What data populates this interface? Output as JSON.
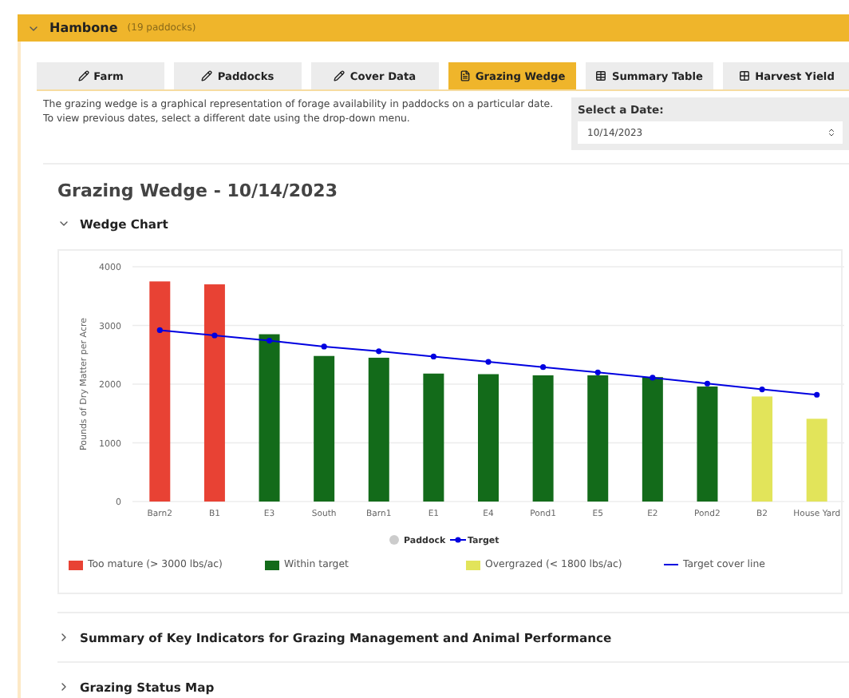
{
  "farm": {
    "name": "Hambone",
    "count": "(19 paddocks)",
    "expanded": true
  },
  "tabs": [
    {
      "label": "Farm",
      "selected": false
    },
    {
      "label": "Paddocks",
      "selected": false
    },
    {
      "label": "Cover Data",
      "selected": false
    },
    {
      "label": "Grazing Wedge",
      "selected": true
    },
    {
      "label": "Summary Table",
      "selected": false
    },
    {
      "label": "Harvest Yield",
      "selected": false
    }
  ],
  "intro": [
    "The grazing wedge is a graphical representation of forage availability in paddocks on a particular date.",
    "To view previous dates, select a different date using the drop-down menu."
  ],
  "date_select": {
    "label": "Select a Date:",
    "value": "10/14/2023"
  },
  "heading": "Grazing Wedge - 10/14/2023",
  "sections": [
    {
      "title": "Wedge Chart",
      "expanded": true,
      "key_items": [
        {
          "label": "Paddock",
          "kind": "dot",
          "color": "#cccccc"
        },
        {
          "label": "Target",
          "kind": "line",
          "color": "#0000e0"
        }
      ],
      "chart_data": {
        "type": "bar",
        "ylabel": "Pounds of Dry Matter per Acre",
        "categories": [
          "Barn2",
          "B1",
          "E3",
          "South",
          "Barn1",
          "E1",
          "E4",
          "Pond1",
          "E5",
          "E2",
          "Pond2",
          "B2",
          "House Yard"
        ],
        "ylim": [
          0,
          4000
        ],
        "yticks": [
          0,
          1000,
          2000,
          3000,
          4000
        ],
        "grid": true,
        "series": [
          {
            "name": "Too mature (> 3000 lbs/ac)",
            "color": "#e84234",
            "values": [
              3750,
              3700,
              null,
              null,
              null,
              null,
              null,
              null,
              null,
              null,
              null,
              null,
              null
            ]
          },
          {
            "name": "Within target",
            "color": "#136b1a",
            "values": [
              null,
              null,
              2850,
              2480,
              2450,
              2180,
              2170,
              2150,
              2150,
              2120,
              1960,
              null,
              null
            ]
          },
          {
            "name": "Overgrazed (< 1800 lbs/ac)",
            "color": "#e2e45a",
            "values": [
              null,
              null,
              null,
              null,
              null,
              null,
              null,
              null,
              null,
              null,
              null,
              1790,
              1410
            ]
          },
          {
            "name": "Target cover line",
            "color": "#0000e0",
            "type": "line",
            "marker": true,
            "values": [
              2920,
              2830,
              2740,
              2640,
              2560,
              2470,
              2380,
              2290,
              2200,
              2110,
              2010,
              1910,
              1820
            ]
          }
        ]
      }
    },
    {
      "title": "Summary of Key Indicators for Grazing Management and Animal Performance",
      "expanded": false
    },
    {
      "title": "Grazing Status Map",
      "expanded": false
    }
  ]
}
